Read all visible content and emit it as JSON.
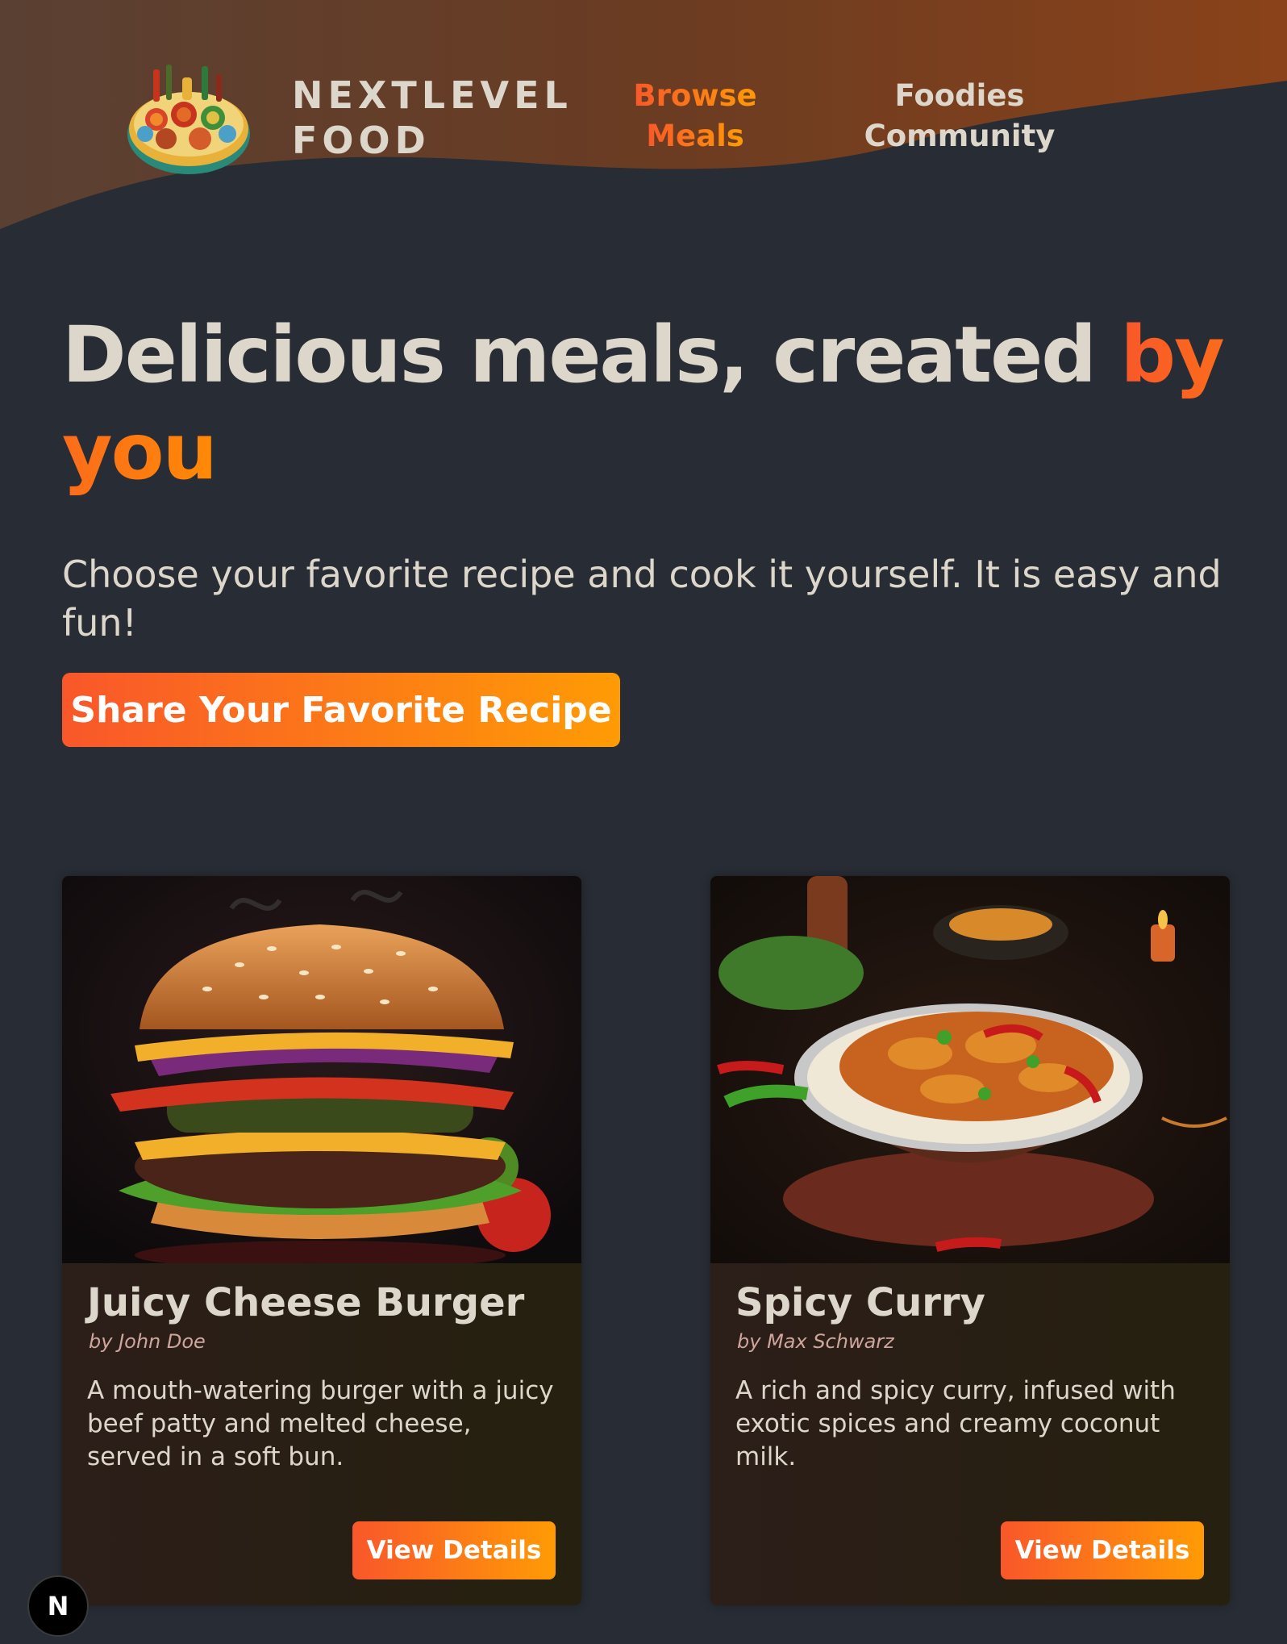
{
  "header": {
    "logo_alt": "NextLevel Food logo",
    "logo_line1": "NEXTLEVEL",
    "logo_line2": "FOOD",
    "nav": [
      {
        "line1": "Browse",
        "line2": "Meals",
        "active": true
      },
      {
        "line1": "Foodies",
        "line2": "Community",
        "active": false
      }
    ]
  },
  "hero": {
    "title_plain": "Delicious meals, created ",
    "title_highlight": "by you",
    "subtitle": "Choose your favorite recipe and cook it yourself. It is easy and fun!",
    "cta_label": "Share Your Favorite Recipe"
  },
  "meals": [
    {
      "title": "Juicy Cheese Burger",
      "author": "by John Doe",
      "summary": "A mouth-watering burger with a juicy beef patty and melted cheese, served in a soft bun.",
      "button_label": "View Details",
      "image_icon": "burger-image"
    },
    {
      "title": "Spicy Curry",
      "author": "by Max Schwarz",
      "summary": "A rich and spicy curry, infused with exotic spices and creamy coconut milk.",
      "button_label": "View Details",
      "image_icon": "curry-image"
    }
  ],
  "next_badge": "N",
  "colors": {
    "background": "#282c34",
    "text": "#ddd6cb",
    "accent_start": "#f9572a",
    "accent_end": "#ff9b05",
    "header_brown": "#5e3a26"
  }
}
